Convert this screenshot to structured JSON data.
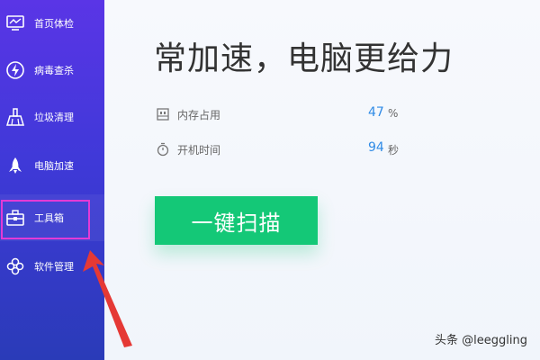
{
  "sidebar": {
    "items": [
      {
        "label": "首页体检",
        "icon": "monitor-icon"
      },
      {
        "label": "病毒查杀",
        "icon": "lightning-shield-icon"
      },
      {
        "label": "垃圾清理",
        "icon": "broom-icon"
      },
      {
        "label": "电脑加速",
        "icon": "rocket-icon"
      },
      {
        "label": "工具箱",
        "icon": "toolbox-icon"
      },
      {
        "label": "软件管理",
        "icon": "apps-icon"
      }
    ],
    "highlighted_item": "工具箱"
  },
  "main": {
    "headline": "常加速，电脑更给力",
    "stats": [
      {
        "label": "内存占用",
        "value": "47",
        "unit": "%",
        "icon": "memory-icon"
      },
      {
        "label": "开机时间",
        "value": "94",
        "unit": "秒",
        "icon": "stopwatch-icon"
      }
    ],
    "scan_button": "一键扫描"
  },
  "watermark": "头条 @leeggling",
  "colors": {
    "sidebar_top": "#5a35e6",
    "sidebar_bottom": "#2a3bb8",
    "highlight": "#e33ad6",
    "button": "#14c877",
    "value": "#2f8be6",
    "arrow": "#e53935"
  }
}
